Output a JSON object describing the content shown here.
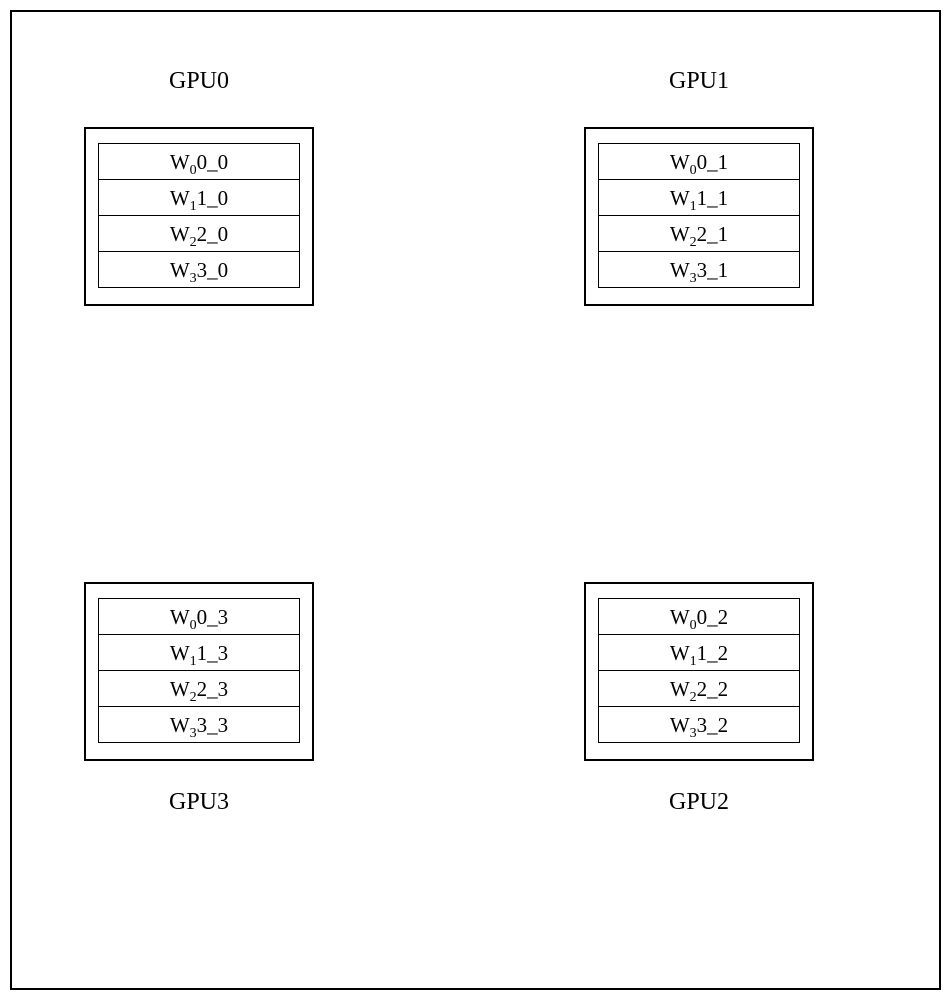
{
  "gpus": {
    "top_left": {
      "label": "GPU0",
      "cells": [
        "W<sub>0</sub>0_0",
        "W<sub>1</sub>1_0",
        "W<sub>2</sub>2_0",
        "W<sub>3</sub>3_0"
      ]
    },
    "top_right": {
      "label": "GPU1",
      "cells": [
        "W<sub>0</sub>0_1",
        "W<sub>1</sub>1_1",
        "W<sub>2</sub>2_1",
        "W<sub>3</sub>3_1"
      ]
    },
    "bot_left": {
      "label": "GPU3",
      "cells": [
        "W<sub>0</sub>0_3",
        "W<sub>1</sub>1_3",
        "W<sub>2</sub>2_3",
        "W<sub>3</sub>3_3"
      ]
    },
    "bot_right": {
      "label": "GPU2",
      "cells": [
        "W<sub>0</sub>0_2",
        "W<sub>1</sub>1_2",
        "W<sub>2</sub>2_2",
        "W<sub>3</sub>3_2"
      ]
    }
  }
}
